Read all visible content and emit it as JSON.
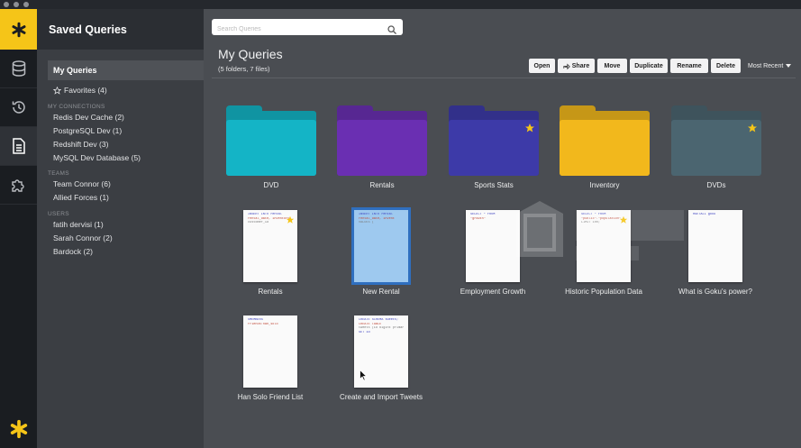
{
  "window": {
    "controls": [
      "close",
      "minimize",
      "zoom"
    ]
  },
  "rail": {
    "logo_icon": "asterisk-logo-icon",
    "items": [
      {
        "name": "database-icon",
        "active": false
      },
      {
        "name": "history-icon",
        "active": false
      },
      {
        "name": "document-icon",
        "active": true
      },
      {
        "name": "puzzle-icon",
        "active": false
      }
    ],
    "bottom_icon": "asterisk-icon"
  },
  "sidebar": {
    "title": "Saved Queries",
    "my_queries": "My Queries",
    "favorites": "Favorites (4)",
    "sections": {
      "connections": "MY CONNECTIONS",
      "teams": "TEAMS",
      "users": "USERS"
    },
    "connections": [
      "Redis Dev Cache (2)",
      "PostgreSQL Dev (1)",
      "Redshift Dev (3)",
      "MySQL Dev Database (5)"
    ],
    "teams": [
      "Team Connor (6)",
      "Allied Forces (1)"
    ],
    "users": [
      "fatih dervisi (1)",
      "Sarah Connor (2)",
      "Bardock (2)"
    ]
  },
  "main": {
    "search_placeholder": "Search Queries",
    "title": "My Queries",
    "subtitle": "(5 folders, 7 files)",
    "toolbar": {
      "open": "Open",
      "share": "Share",
      "move": "Move",
      "duplicate": "Duplicate",
      "rename": "Rename",
      "delete": "Delete",
      "sort": "Most Recent"
    },
    "folders": [
      {
        "label": "DVD",
        "color": "#14b4c6",
        "starred": false
      },
      {
        "label": "Rentals",
        "color": "#6a2fb2",
        "starred": false
      },
      {
        "label": "Sports Stats",
        "color": "#3d3aa8",
        "starred": true
      },
      {
        "label": "Inventory",
        "color": "#f2b81c",
        "starred": false
      },
      {
        "label": "DVDs",
        "color": "#4b6570",
        "starred": true
      }
    ],
    "files": [
      {
        "label": "Rentals",
        "starred": true,
        "selected": false,
        "lines": [
          "INSERT INTO rental",
          "rental_date, inventory",
          "customer_id"
        ]
      },
      {
        "label": "New Rental",
        "starred": false,
        "selected": true,
        "lines": [
          "INSERT INTO rental",
          "rental_date, invent",
          "VALUES ("
        ]
      },
      {
        "label": "Employment Growth",
        "starred": false,
        "selected": false,
        "lines": [
          "SELECT * FROM",
          "\"growth\""
        ]
      },
      {
        "label": "Historic Population Data",
        "starred": true,
        "selected": false,
        "lines": [
          "SELECT * FROM",
          "\"public\".\"population\"",
          "LIMIT 100;"
        ]
      },
      {
        "label": "What is Goku's power?",
        "starred": false,
        "selected": false,
        "lines": [
          "HGETALL goku"
        ]
      },
      {
        "label": "Han Solo Friend List",
        "starred": false,
        "selected": false,
        "lines": [
          "SMEMBERS",
          "friends:han_solo"
        ]
      },
      {
        "label": "Create and Import Tweets",
        "starred": false,
        "selected": false,
        "lines": [
          "CREATE SCHEMA tweets;",
          "CREATE TABLE",
          "tweets (id bigint primary",
          "SET id"
        ]
      }
    ]
  },
  "colors": {
    "accent": "#f5c518",
    "star": "#f5c518",
    "selection": "#2f6fbf"
  }
}
